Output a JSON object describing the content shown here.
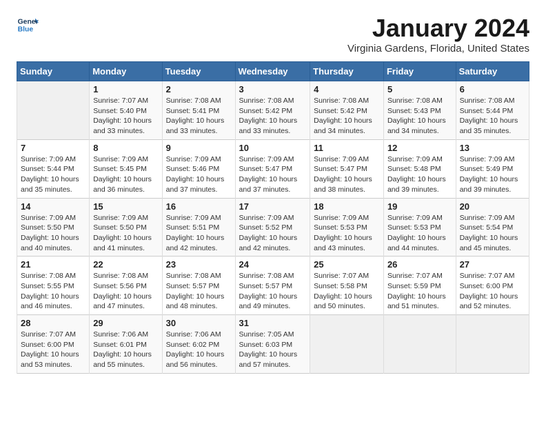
{
  "header": {
    "logo_line1": "General",
    "logo_line2": "Blue",
    "month": "January 2024",
    "location": "Virginia Gardens, Florida, United States"
  },
  "days_of_week": [
    "Sunday",
    "Monday",
    "Tuesday",
    "Wednesday",
    "Thursday",
    "Friday",
    "Saturday"
  ],
  "weeks": [
    [
      {
        "num": "",
        "info": ""
      },
      {
        "num": "1",
        "info": "Sunrise: 7:07 AM\nSunset: 5:40 PM\nDaylight: 10 hours\nand 33 minutes."
      },
      {
        "num": "2",
        "info": "Sunrise: 7:08 AM\nSunset: 5:41 PM\nDaylight: 10 hours\nand 33 minutes."
      },
      {
        "num": "3",
        "info": "Sunrise: 7:08 AM\nSunset: 5:42 PM\nDaylight: 10 hours\nand 33 minutes."
      },
      {
        "num": "4",
        "info": "Sunrise: 7:08 AM\nSunset: 5:42 PM\nDaylight: 10 hours\nand 34 minutes."
      },
      {
        "num": "5",
        "info": "Sunrise: 7:08 AM\nSunset: 5:43 PM\nDaylight: 10 hours\nand 34 minutes."
      },
      {
        "num": "6",
        "info": "Sunrise: 7:08 AM\nSunset: 5:44 PM\nDaylight: 10 hours\nand 35 minutes."
      }
    ],
    [
      {
        "num": "7",
        "info": "Sunrise: 7:09 AM\nSunset: 5:44 PM\nDaylight: 10 hours\nand 35 minutes."
      },
      {
        "num": "8",
        "info": "Sunrise: 7:09 AM\nSunset: 5:45 PM\nDaylight: 10 hours\nand 36 minutes."
      },
      {
        "num": "9",
        "info": "Sunrise: 7:09 AM\nSunset: 5:46 PM\nDaylight: 10 hours\nand 37 minutes."
      },
      {
        "num": "10",
        "info": "Sunrise: 7:09 AM\nSunset: 5:47 PM\nDaylight: 10 hours\nand 37 minutes."
      },
      {
        "num": "11",
        "info": "Sunrise: 7:09 AM\nSunset: 5:47 PM\nDaylight: 10 hours\nand 38 minutes."
      },
      {
        "num": "12",
        "info": "Sunrise: 7:09 AM\nSunset: 5:48 PM\nDaylight: 10 hours\nand 39 minutes."
      },
      {
        "num": "13",
        "info": "Sunrise: 7:09 AM\nSunset: 5:49 PM\nDaylight: 10 hours\nand 39 minutes."
      }
    ],
    [
      {
        "num": "14",
        "info": "Sunrise: 7:09 AM\nSunset: 5:50 PM\nDaylight: 10 hours\nand 40 minutes."
      },
      {
        "num": "15",
        "info": "Sunrise: 7:09 AM\nSunset: 5:50 PM\nDaylight: 10 hours\nand 41 minutes."
      },
      {
        "num": "16",
        "info": "Sunrise: 7:09 AM\nSunset: 5:51 PM\nDaylight: 10 hours\nand 42 minutes."
      },
      {
        "num": "17",
        "info": "Sunrise: 7:09 AM\nSunset: 5:52 PM\nDaylight: 10 hours\nand 42 minutes."
      },
      {
        "num": "18",
        "info": "Sunrise: 7:09 AM\nSunset: 5:53 PM\nDaylight: 10 hours\nand 43 minutes."
      },
      {
        "num": "19",
        "info": "Sunrise: 7:09 AM\nSunset: 5:53 PM\nDaylight: 10 hours\nand 44 minutes."
      },
      {
        "num": "20",
        "info": "Sunrise: 7:09 AM\nSunset: 5:54 PM\nDaylight: 10 hours\nand 45 minutes."
      }
    ],
    [
      {
        "num": "21",
        "info": "Sunrise: 7:08 AM\nSunset: 5:55 PM\nDaylight: 10 hours\nand 46 minutes."
      },
      {
        "num": "22",
        "info": "Sunrise: 7:08 AM\nSunset: 5:56 PM\nDaylight: 10 hours\nand 47 minutes."
      },
      {
        "num": "23",
        "info": "Sunrise: 7:08 AM\nSunset: 5:57 PM\nDaylight: 10 hours\nand 48 minutes."
      },
      {
        "num": "24",
        "info": "Sunrise: 7:08 AM\nSunset: 5:57 PM\nDaylight: 10 hours\nand 49 minutes."
      },
      {
        "num": "25",
        "info": "Sunrise: 7:07 AM\nSunset: 5:58 PM\nDaylight: 10 hours\nand 50 minutes."
      },
      {
        "num": "26",
        "info": "Sunrise: 7:07 AM\nSunset: 5:59 PM\nDaylight: 10 hours\nand 51 minutes."
      },
      {
        "num": "27",
        "info": "Sunrise: 7:07 AM\nSunset: 6:00 PM\nDaylight: 10 hours\nand 52 minutes."
      }
    ],
    [
      {
        "num": "28",
        "info": "Sunrise: 7:07 AM\nSunset: 6:00 PM\nDaylight: 10 hours\nand 53 minutes."
      },
      {
        "num": "29",
        "info": "Sunrise: 7:06 AM\nSunset: 6:01 PM\nDaylight: 10 hours\nand 55 minutes."
      },
      {
        "num": "30",
        "info": "Sunrise: 7:06 AM\nSunset: 6:02 PM\nDaylight: 10 hours\nand 56 minutes."
      },
      {
        "num": "31",
        "info": "Sunrise: 7:05 AM\nSunset: 6:03 PM\nDaylight: 10 hours\nand 57 minutes."
      },
      {
        "num": "",
        "info": ""
      },
      {
        "num": "",
        "info": ""
      },
      {
        "num": "",
        "info": ""
      }
    ]
  ]
}
